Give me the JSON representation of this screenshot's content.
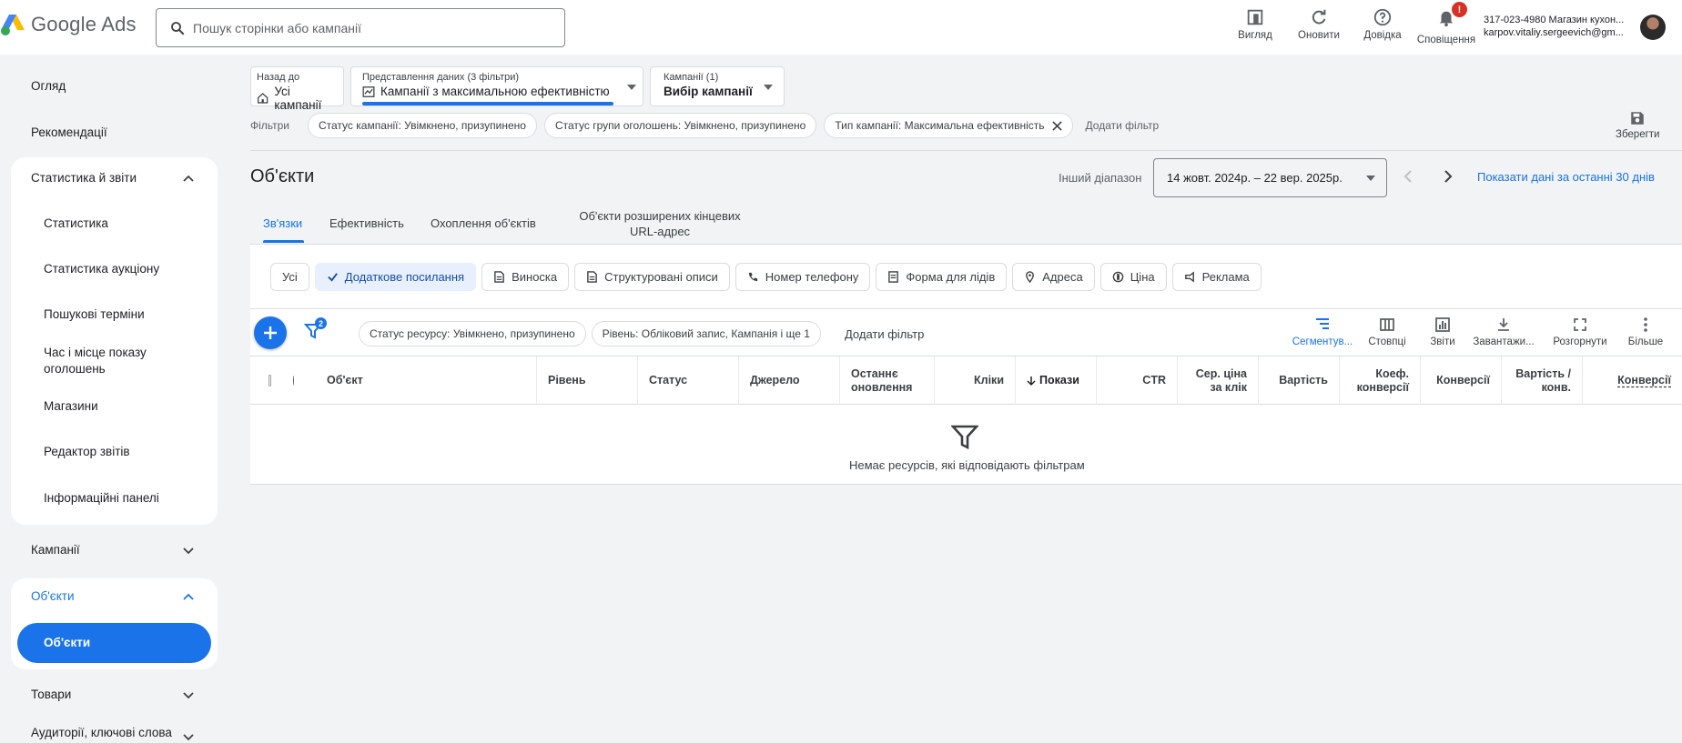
{
  "app": {
    "name": "Google Ads"
  },
  "search": {
    "placeholder": "Пошук сторінки або кампанії"
  },
  "top_tools": [
    {
      "label": "Вигляд",
      "icon": "appearance-icon"
    },
    {
      "label": "Оновити",
      "icon": "refresh-icon"
    },
    {
      "label": "Довідка",
      "icon": "help-icon"
    },
    {
      "label": "Сповіщення",
      "icon": "bell-icon",
      "badge": "!"
    }
  ],
  "account": {
    "line1": "317-023-4980 Магазин кухон...",
    "line2": "karpov.vitaliy.sergeevich@gm..."
  },
  "sidebar": {
    "overview": "Огляд",
    "recommendations": "Рекомендації",
    "stats_group": {
      "title": "Статистика й звіти",
      "items": [
        "Статистика",
        "Статистика аукціону",
        "Пошукові терміни",
        "Час і місце показу оголошень",
        "Магазини",
        "Редактор звітів",
        "Інформаційні панелі"
      ]
    },
    "campaigns": "Кампанії",
    "assets_group": {
      "title": "Об'єкти",
      "active_item": "Об'єкти"
    },
    "products": "Товари",
    "audiences": "Аудиторії, ключові слова"
  },
  "breadcrumbs": {
    "back": {
      "small": "Назад до",
      "big": "Усі кампанії"
    },
    "view": {
      "small": "Представлення даних (3 фільтри)",
      "big": "Кампанії з максимальною ефективністю"
    },
    "campaigns": {
      "small": "Кампанії (1)",
      "big": "Вибір кампанії"
    }
  },
  "filters": {
    "label": "Фільтри",
    "chips": [
      "Статус кампанії: Увімкнено, призупинено",
      "Статус групи оголошень: Увімкнено, призупинено",
      "Тип кампанії: Максимальна ефективність"
    ],
    "add": "Додати фільтр",
    "save": "Зберегти"
  },
  "page": {
    "title": "Об'єкти"
  },
  "date_range": {
    "label": "Інший діапазон",
    "value": "14 жовт. 2024р. – 22 вер. 2025р.",
    "show_30": "Показати дані за останні 30 днів"
  },
  "tabs": [
    {
      "label": "Зв'язки",
      "active": true
    },
    {
      "label": "Ефективність"
    },
    {
      "label": "Охоплення об'єктів"
    },
    {
      "label": "Об'єкти розширених кінцевих URL-адрес"
    }
  ],
  "asset_types": [
    {
      "label": "Усі"
    },
    {
      "label": "Додаткове посилання",
      "icon": "check-icon",
      "selected": true
    },
    {
      "label": "Виноска",
      "icon": "callout-icon"
    },
    {
      "label": "Структуровані описи",
      "icon": "structured-snippet-icon"
    },
    {
      "label": "Номер телефону",
      "icon": "phone-icon"
    },
    {
      "label": "Форма для лідів",
      "icon": "lead-form-icon"
    },
    {
      "label": "Адреса",
      "icon": "location-icon"
    },
    {
      "label": "Ціна",
      "icon": "price-icon"
    },
    {
      "label": "Реклама",
      "icon": "promotion-icon"
    }
  ],
  "table_filters": {
    "badge": "2",
    "chips": [
      "Статус ресурсу: Увімкнено, призупинено",
      "Рівень: Обліковий запис, Кампанія і ще 1"
    ],
    "add": "Додати фільтр"
  },
  "table_tools": [
    {
      "label": "Сегментув...",
      "icon": "segment-icon",
      "active": true
    },
    {
      "label": "Стовпці",
      "icon": "columns-icon"
    },
    {
      "label": "Звіти",
      "icon": "reports-icon"
    },
    {
      "label": "Завантажи...",
      "icon": "download-icon"
    },
    {
      "label": "Розгорнути",
      "icon": "expand-icon"
    },
    {
      "label": "Більше",
      "icon": "more-icon"
    }
  ],
  "columns": [
    "Об'єкт",
    "Рівень",
    "Статус",
    "Джерело",
    "Останнє оновлення",
    "Кліки",
    "Покази",
    "CTR",
    "Сер. ціна за клік",
    "Вартість",
    "Коеф. конверсії",
    "Конверсії",
    "Вартість / конв.",
    "Конверсії"
  ],
  "empty_message": "Немає ресурсів, які відповідають фільтрам",
  "colors": {
    "accent": "#1a73e8",
    "background": "#f1f3f4",
    "alert": "#d93025"
  }
}
